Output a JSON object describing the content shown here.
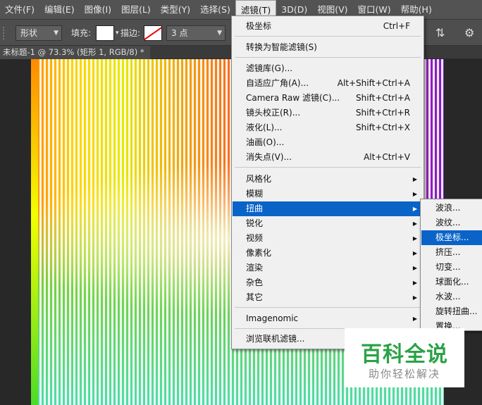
{
  "menubar": {
    "items": [
      "文件(F)",
      "编辑(E)",
      "图像(I)",
      "图层(L)",
      "类型(Y)",
      "选择(S)",
      "滤镜(T)",
      "3D(D)",
      "视图(V)",
      "窗口(W)",
      "帮助(H)"
    ],
    "active": "滤镜(T)"
  },
  "options": {
    "mode_value": "形状",
    "fill_label": "填充:",
    "stroke_label": "描边:",
    "stroke_width_value": "3 点"
  },
  "document": {
    "tab_title": "未标题-1 @ 73.3% (矩形 1, RGB/8) *"
  },
  "filter_menu": {
    "items": [
      {
        "label": "极坐标",
        "shortcut": "Ctrl+F"
      },
      {
        "label": "转换为智能滤镜(S)",
        "shortcut": ""
      },
      {
        "label": "滤镜库(G)...",
        "shortcut": ""
      },
      {
        "label": "自适应广角(A)...",
        "shortcut": "Alt+Shift+Ctrl+A"
      },
      {
        "label": "Camera Raw 滤镜(C)...",
        "shortcut": "Shift+Ctrl+A"
      },
      {
        "label": "镜头校正(R)...",
        "shortcut": "Shift+Ctrl+R"
      },
      {
        "label": "液化(L)...",
        "shortcut": "Shift+Ctrl+X"
      },
      {
        "label": "油画(O)...",
        "shortcut": ""
      },
      {
        "label": "消失点(V)...",
        "shortcut": "Alt+Ctrl+V"
      },
      {
        "label": "风格化",
        "shortcut": ""
      },
      {
        "label": "模糊",
        "shortcut": ""
      },
      {
        "label": "扭曲",
        "shortcut": ""
      },
      {
        "label": "锐化",
        "shortcut": ""
      },
      {
        "label": "视频",
        "shortcut": ""
      },
      {
        "label": "像素化",
        "shortcut": ""
      },
      {
        "label": "渲染",
        "shortcut": ""
      },
      {
        "label": "杂色",
        "shortcut": ""
      },
      {
        "label": "其它",
        "shortcut": ""
      },
      {
        "label": "Imagenomic",
        "shortcut": ""
      },
      {
        "label": "浏览联机滤镜...",
        "shortcut": ""
      }
    ],
    "highlighted": "扭曲"
  },
  "distort_submenu": {
    "items": [
      "波浪...",
      "波纹...",
      "极坐标...",
      "挤压...",
      "切变...",
      "球面化...",
      "水波...",
      "旋转扭曲...",
      "置换..."
    ],
    "highlighted": "极坐标..."
  },
  "watermark": {
    "title": "百科全说",
    "subtitle": "助你轻松解决"
  },
  "colors": {
    "menu_highlight": "#0a64c8",
    "watermark_green": "#2ba245"
  }
}
